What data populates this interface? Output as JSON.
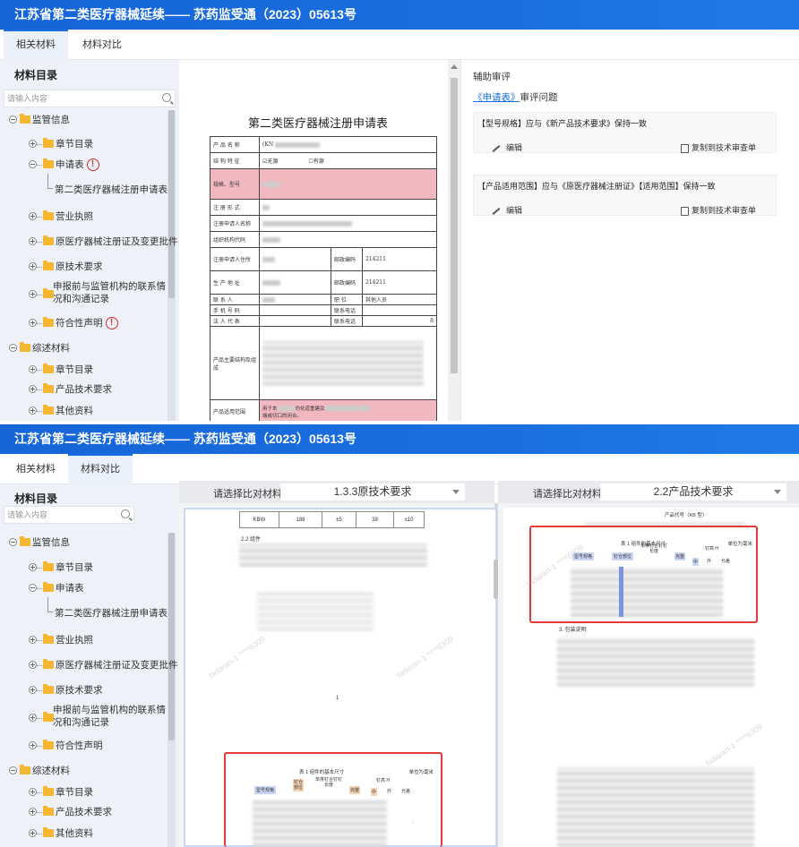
{
  "title": "江苏省第二类医疗器械延续—— 苏药监受通（2023）05613号",
  "screen1": {
    "tabs": [
      "相关材料",
      "材料对比"
    ],
    "active_tab": 0
  },
  "screen2": {
    "tabs": [
      "相关材料",
      "材料对比"
    ],
    "active_tab": 1
  },
  "sidebar": {
    "title": "材料目录",
    "search_placeholder": "请输入内容",
    "tree": {
      "group1": "监管信息",
      "chapter": "章节目录",
      "application": "申请表",
      "application_child": "第二类医疗器械注册申请表",
      "license": "营业执照",
      "cert": "原医疗器械注册证及变更批件",
      "orig_req": "原技术要求",
      "comm_1": "申报前与监管机构的联系情",
      "comm_2": "况和沟通记录",
      "declaration": "符合性声明",
      "group2": "综述材料",
      "chapter2": "章节目录",
      "product_desc": "产品技术要求",
      "other": "其他资料"
    },
    "warn_mark": "!"
  },
  "document": {
    "form_title": "第二类医疗器械注册申请表",
    "rows": {
      "product_name": "产 品 名 称",
      "structure": "结 构 特 征",
      "structure_opt1": "☑无源",
      "structure_opt2": "☐有源",
      "model": "规格、型号",
      "reg_form": "注 册 形 式",
      "applicant_name": "注册申请人名称",
      "org_code": "组织机构代码",
      "applicant_addr": "注册申请人住所",
      "postcode_label": "邮政编码",
      "postcode_value": "214211",
      "prod_addr": "生 产 地 址",
      "postcode_label2": "邮政编码",
      "postcode_value2": "214211",
      "contact": "联 系 人",
      "position": "职 位",
      "position_value": "其他人员",
      "mobile": "手 机 号 码",
      "contact_phone": "联系电话",
      "legal_rep": "法 人 代 表",
      "contact_phone2": "联系电话",
      "phone_tail": "8",
      "main_structure": "产品主要结构及组成",
      "scope": "产品适用范围",
      "scope_text_1": "用于本",
      "scope_text_2": "的化道重建及",
      "scope_text_3": "端或切口的闭合。",
      "model_value": "(KN"
    }
  },
  "review": {
    "header": "辅助审评",
    "sub_link": "《申请表》",
    "sub_text": "审评问题",
    "items": [
      {
        "text": "【型号规格】应与《新产品技术要求》保持一致",
        "edit": "编辑",
        "copy": "复制到技术审查单"
      },
      {
        "text": "【产品适用范围】应与《原医疗器械注册证》【适用范围】保持一致",
        "edit": "编辑",
        "copy": "复制到技术审查单"
      }
    ]
  },
  "compare": {
    "left_label": "请选择比对材料",
    "left_value": "1.3.3原技术要求",
    "right_label": "请选择比对材料",
    "right_value": "2.2产品技术要求",
    "left_page": {
      "row_cells": [
        "KBW",
        "188",
        "±5",
        "38",
        "±10"
      ],
      "section": "2.2 组件",
      "table_title": "表 1 组件的基本尺寸",
      "unit": "单位为毫米",
      "headers": [
        "型号规格",
        "钉仓部位",
        "单排钉合钉钉长度",
        "完整",
        "钉高 H",
        "中",
        "外",
        "允差"
      ],
      "page_mark": "1"
    },
    "right_page": {
      "product_code": "产品代号（KB 型）",
      "table_title": "表 1 组件的基本尺寸",
      "unit": "单位为毫米",
      "headers": [
        "型号规格",
        "钉仓部位",
        "单排钉合钉钉长度",
        "完整",
        "钉高 H",
        "中",
        "外",
        "允差"
      ],
      "packaging": "3. 包装说明"
    }
  }
}
